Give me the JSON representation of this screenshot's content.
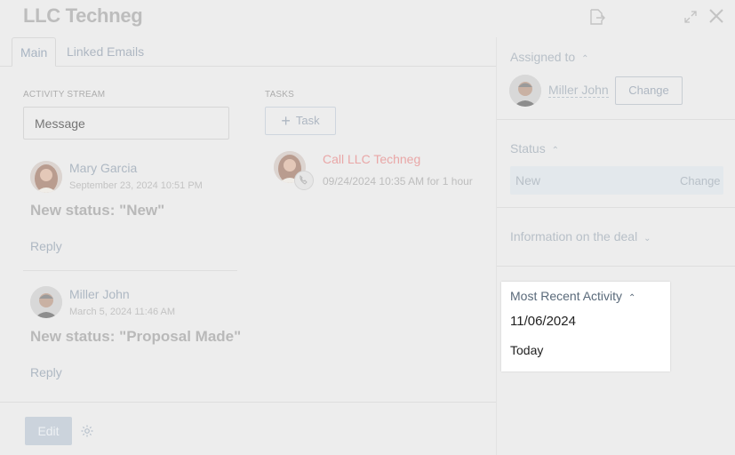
{
  "header": {
    "title": "LLC Techneg"
  },
  "tabs": [
    {
      "label": "Main",
      "active": true
    },
    {
      "label": "Linked Emails",
      "active": false
    }
  ],
  "activity": {
    "section_label": "ACTIVITY STREAM",
    "message_placeholder": "Message",
    "entries": [
      {
        "author": "Mary Garcia",
        "date": "September 23, 2024 10:51 PM",
        "text": "New status: \"New\"",
        "reply": "Reply"
      },
      {
        "author": "Miller John",
        "date": "March 5, 2024 11:46 AM",
        "text": "New status: \"Proposal Made\"",
        "reply": "Reply"
      }
    ]
  },
  "tasks": {
    "section_label": "TASKS",
    "add_label": "Task",
    "items": [
      {
        "title": "Call LLC Techneg",
        "meta": "09/24/2024 10:35 AM for 1 hour"
      }
    ]
  },
  "sidebar": {
    "assigned": {
      "label": "Assigned to",
      "user": "Miller John",
      "change_label": "Change"
    },
    "status": {
      "label": "Status",
      "value": "New",
      "change_label": "Change"
    },
    "info": {
      "label": "Information on the deal"
    },
    "recent": {
      "label": "Most Recent Activity",
      "date": "11/06/2024",
      "relative": "Today"
    }
  },
  "footer": {
    "edit_label": "Edit"
  },
  "colors": {
    "background": "#ededed",
    "accent_link": "#aeb8c3",
    "task_title": "#e9a7a7",
    "highlight_bg": "#ffffff"
  },
  "icons": [
    "export-icon",
    "expand-icon",
    "close-icon",
    "plus-icon",
    "phone-icon",
    "chevron-up-icon",
    "chevron-down-icon",
    "settings-gear-icon"
  ]
}
